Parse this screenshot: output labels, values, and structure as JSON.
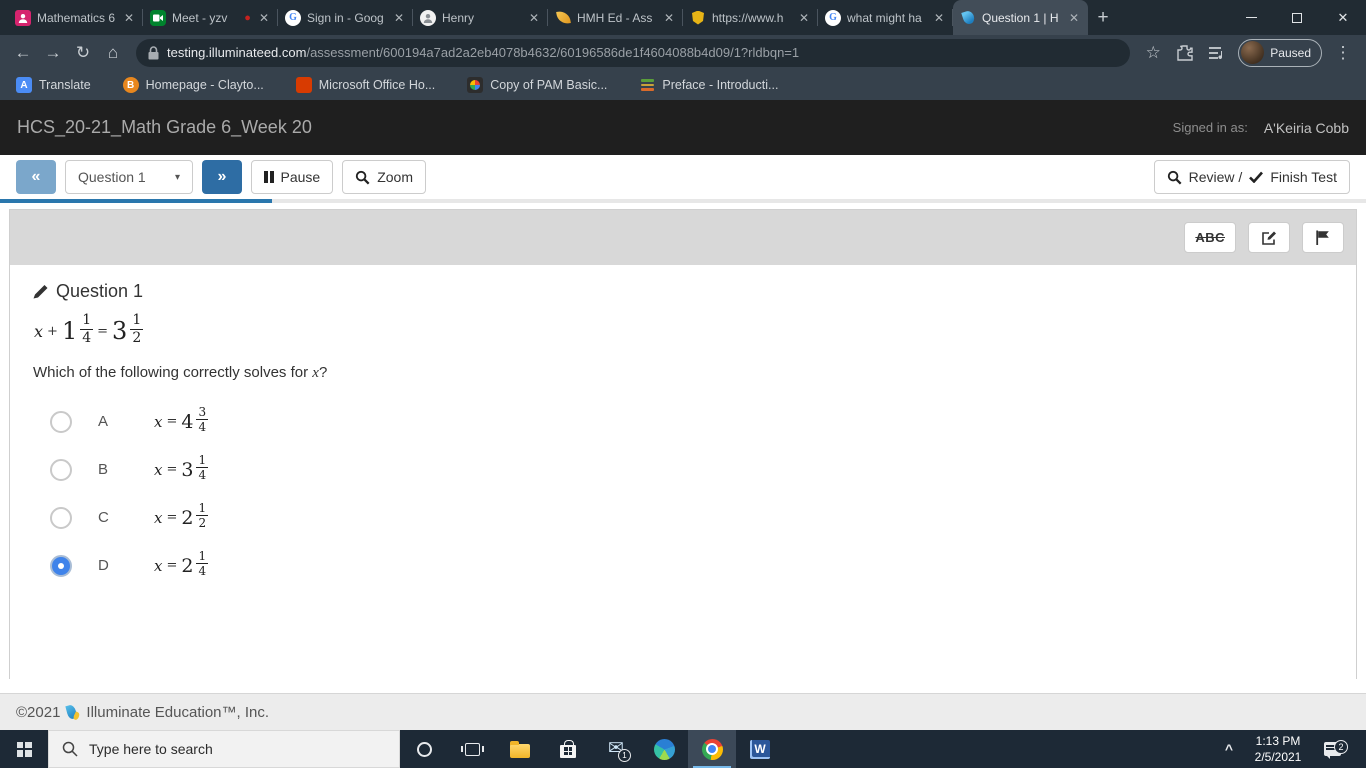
{
  "browser": {
    "tabs": [
      {
        "label": "Mathematics 6",
        "icon": "person-pink"
      },
      {
        "label": "Meet - yzv",
        "icon": "google-meet",
        "recording": true
      },
      {
        "label": "Sign in - Goog",
        "icon": "google-g"
      },
      {
        "label": "Henry",
        "icon": "hcs-person"
      },
      {
        "label": "HMH Ed - Ass",
        "icon": "hmh-leaf"
      },
      {
        "label": "https://www.h",
        "icon": "shield"
      },
      {
        "label": "what might ha",
        "icon": "google-g"
      },
      {
        "label": "Question 1 | H",
        "icon": "illuminate-flame",
        "active": true
      }
    ],
    "address": {
      "domain": "testing.illuminateed.com",
      "path": "/assessment/600194a7ad2a2eb4078b4632/60196586de1f4604088b4d09/1?rldbqn=1"
    },
    "profile_badge": "Paused",
    "bookmarks": [
      {
        "label": "Translate"
      },
      {
        "label": "Homepage - Clayto..."
      },
      {
        "label": "Microsoft Office Ho..."
      },
      {
        "label": "Copy of PAM Basic..."
      },
      {
        "label": "Preface - Introducti..."
      }
    ],
    "icons": {
      "back": "←",
      "forward": "→",
      "reload": "↻",
      "home": "⌂",
      "star": "☆",
      "menu": "⋮",
      "new_tab": "+",
      "close_window": "✕",
      "tab_close": "✕",
      "rec_dot": "●",
      "caret_down": "▾",
      "back_double": "«",
      "forward_double": "»",
      "tray_chevron": "^",
      "bm_translate_letter": "A",
      "bm_homepage_letter": "B",
      "google_letter": "G"
    }
  },
  "header": {
    "title": "HCS_20-21_Math Grade 6_Week 20",
    "signed_in_label": "Signed in as:",
    "user_name": "A'Keiria Cobb"
  },
  "toolbar": {
    "question_select_value": "Question 1",
    "pause_label": "Pause",
    "zoom_label": "Zoom",
    "review_label": "Review /",
    "finish_label": "Finish Test",
    "progress_percent": 19.9
  },
  "question_tools": {
    "eliminator_label": "ABC"
  },
  "question": {
    "heading": "Question 1",
    "equation": {
      "var": "x",
      "op": "+",
      "whole1": "1",
      "num1": "1",
      "den1": "4",
      "eq": "=",
      "whole2": "3",
      "num2": "1",
      "den2": "2"
    },
    "prompt_before": "Which of the following correctly solves for ",
    "prompt_var": "x",
    "prompt_after": "?",
    "options": [
      {
        "letter": "A",
        "var": "x",
        "eq": "=",
        "whole": "4",
        "num": "3",
        "den": "4",
        "selected": false
      },
      {
        "letter": "B",
        "var": "x",
        "eq": "=",
        "whole": "3",
        "num": "1",
        "den": "4",
        "selected": false
      },
      {
        "letter": "C",
        "var": "x",
        "eq": "=",
        "whole": "2",
        "num": "1",
        "den": "2",
        "selected": false
      },
      {
        "letter": "D",
        "var": "x",
        "eq": "=",
        "whole": "2",
        "num": "1",
        "den": "4",
        "selected": true
      }
    ]
  },
  "footer": {
    "copyright": "©2021",
    "company": "Illuminate Education™, Inc."
  },
  "taskbar": {
    "search_placeholder": "Type here to search",
    "time": "1:13 PM",
    "date": "2/5/2021",
    "notification_count": "2",
    "mail_badge": "1"
  }
}
